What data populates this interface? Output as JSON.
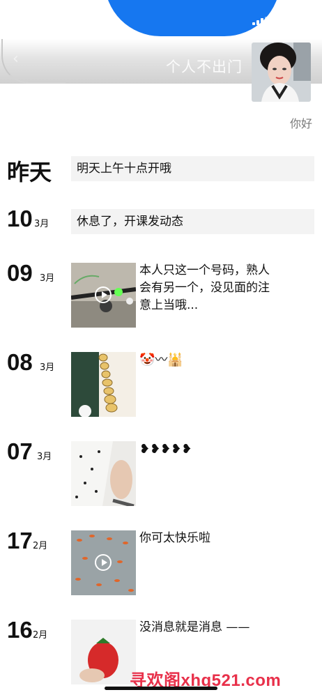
{
  "header": {
    "back_icon": "chevron-left-icon",
    "title": "个人不出门",
    "bio": "你好",
    "brand_color": "#1677f0"
  },
  "moments": [
    {
      "day": "昨天",
      "month": "",
      "type": "text",
      "text": "明天上午十点开哦"
    },
    {
      "day": "10",
      "month": "3月",
      "type": "text",
      "text": "休息了，开课发动态"
    },
    {
      "day": "09",
      "month": "3月",
      "type": "video",
      "text": "本人只这一个号码，熟人会有另一个，没见面的注意上当哦..."
    },
    {
      "day": "08",
      "month": "3月",
      "type": "image",
      "text": "🤡〰🕌"
    },
    {
      "day": "07",
      "month": "3月",
      "type": "image",
      "text": "❥❥❥❥❥"
    },
    {
      "day": "17",
      "month": "2月",
      "type": "video",
      "text": "你可太快乐啦"
    },
    {
      "day": "16",
      "month": "2月",
      "type": "image",
      "text": "没消息就是消息 ——"
    }
  ],
  "watermark": "寻欢阁xhg521.com"
}
